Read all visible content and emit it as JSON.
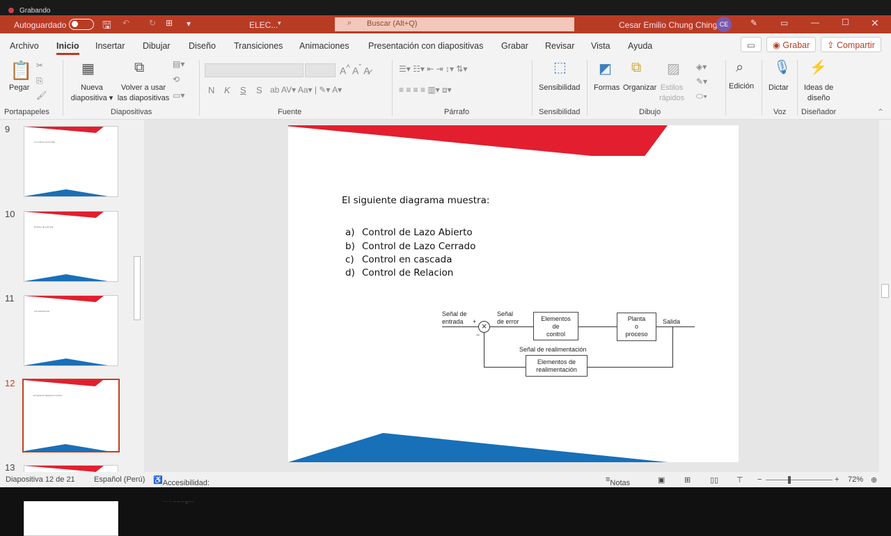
{
  "recording": {
    "label": "Grabando"
  },
  "titlebar": {
    "autosave_label": "Autoguardado",
    "autosave_on": false,
    "filename": "ELEC...",
    "search_placeholder": "Buscar (Alt+Q)",
    "user_name": "Cesar Emilio Chung Ching",
    "user_initials": "CE",
    "accent": "#b83c24"
  },
  "tabs": [
    "Archivo",
    "Inicio",
    "Insertar",
    "Dibujar",
    "Diseño",
    "Transiciones",
    "Animaciones",
    "Presentación con diapositivas",
    "Grabar",
    "Revisar",
    "Vista",
    "Ayuda"
  ],
  "active_tab": "Inicio",
  "tab_buttons": {
    "record": "Grabar",
    "share": "Compartir"
  },
  "ribbon": {
    "paste": "Pegar",
    "new_slide": [
      "Nueva",
      "diapositiva"
    ],
    "reuse": [
      "Volver a usar",
      "las diapositivas"
    ],
    "sensitivity": "Sensibilidad",
    "shapes": "Formas",
    "arrange": "Organizar",
    "quick_styles": [
      "Estilos",
      "rápidos"
    ],
    "editing": "Edición",
    "dictate": "Dictar",
    "designer": [
      "Ideas de",
      "diseño"
    ],
    "font_buttons": [
      "N",
      "K",
      "S",
      "S"
    ],
    "groups": [
      "Portapapeles",
      "Diapositivas",
      "Fuente",
      "Párrafo",
      "Sensibilidad",
      "Dibujo",
      "Voz",
      "Diseñador"
    ]
  },
  "thumbnails": [
    {
      "number": "9",
      "text": "Los valores de la tabla"
    },
    {
      "number": "10",
      "text": "El factor de potencia"
    },
    {
      "number": "11",
      "text": "Las aplicaciones"
    },
    {
      "number": "12",
      "text": "El siguiente diagrama muestra:",
      "selected": true
    },
    {
      "number": "13",
      "text": ""
    }
  ],
  "slide": {
    "question": "El siguiente diagrama muestra:",
    "options": [
      {
        "letter": "a)",
        "text": "Control de Lazo Abierto"
      },
      {
        "letter": "b)",
        "text": "Control de Lazo Cerrado"
      },
      {
        "letter": "c)",
        "text": "Control en cascada"
      },
      {
        "letter": "d)",
        "text": "Control de Relacion"
      }
    ],
    "diagram": {
      "input": [
        "Señal de",
        "entrada"
      ],
      "error": [
        "Señal",
        "de error"
      ],
      "plus": "+",
      "minus": "−",
      "control": [
        "Elementos",
        "de",
        "control"
      ],
      "plant": [
        "Planta",
        "o",
        "proceso"
      ],
      "output": "Salida",
      "feedback_signal": "Señal de realimentación",
      "feedback": [
        "Elementos de",
        "realimentación"
      ]
    }
  },
  "status": {
    "slide": "Diapositiva 12 de 21",
    "language": "Español (Perú)",
    "accessibility": "Accesibilidad: es necesario investigar",
    "notes": "Notas",
    "zoom": "72%"
  }
}
